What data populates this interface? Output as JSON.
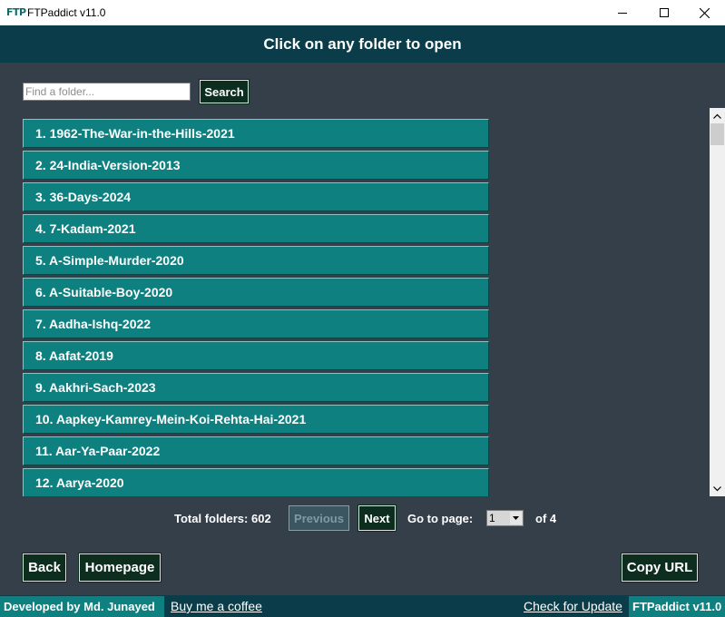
{
  "window": {
    "logo_text": "FTP",
    "title": "FTPaddict v11.0"
  },
  "header": {
    "text": "Click on any folder to open"
  },
  "search": {
    "placeholder": "Find a folder...",
    "value": "",
    "button_label": "Search"
  },
  "folders": [
    "1. 1962-The-War-in-the-Hills-2021",
    "2. 24-India-Version-2013",
    "3. 36-Days-2024",
    "4. 7-Kadam-2021",
    "5. A-Simple-Murder-2020",
    "6. A-Suitable-Boy-2020",
    "7. Aadha-Ishq-2022",
    "8. Aafat-2019",
    "9. Aakhri-Sach-2023",
    "10. Aapkey-Kamrey-Mein-Koi-Rehta-Hai-2021",
    "11. Aar-Ya-Paar-2022",
    "12. Aarya-2020"
  ],
  "pagination": {
    "total_label": "Total folders: 602",
    "previous_label": "Previous",
    "next_label": "Next",
    "goto_label": "Go to page:",
    "current_page": "1",
    "of_label": "of 4"
  },
  "buttons": {
    "back": "Back",
    "homepage": "Homepage",
    "copy_url": "Copy URL"
  },
  "statusbar": {
    "developer": "Developed by  Md. Junayed",
    "coffee_link": "Buy me a coffee",
    "update_link": "Check for Update",
    "version": "FTPaddict v11.0"
  },
  "colors": {
    "header_bg": "#0b3c49",
    "main_bg": "#343f4a",
    "folder_bg": "#0e8080",
    "button_bg": "#0d2e1f"
  }
}
